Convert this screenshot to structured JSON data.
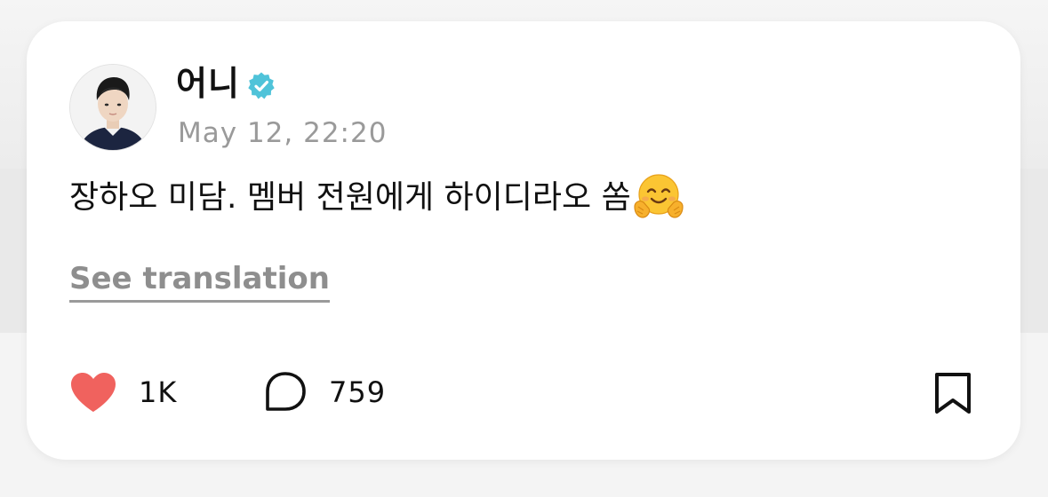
{
  "post": {
    "username": "어니",
    "verified_icon": "verified-badge-icon",
    "timestamp": "May 12, 22:20",
    "text": "장하오 미담. 멤버 전원에게 하이디라오 쏨",
    "emoji": "hugging-face-emoji",
    "translate_label": "See translation"
  },
  "actions": {
    "likes_icon": "heart-icon",
    "likes": "1K",
    "comments_icon": "comment-bubble-icon",
    "comments": "759",
    "bookmark_icon": "bookmark-icon"
  },
  "colors": {
    "heart": "#f0625e",
    "verified": "#4fc3d9",
    "muted_text": "#9a9a9a",
    "text": "#111111"
  }
}
